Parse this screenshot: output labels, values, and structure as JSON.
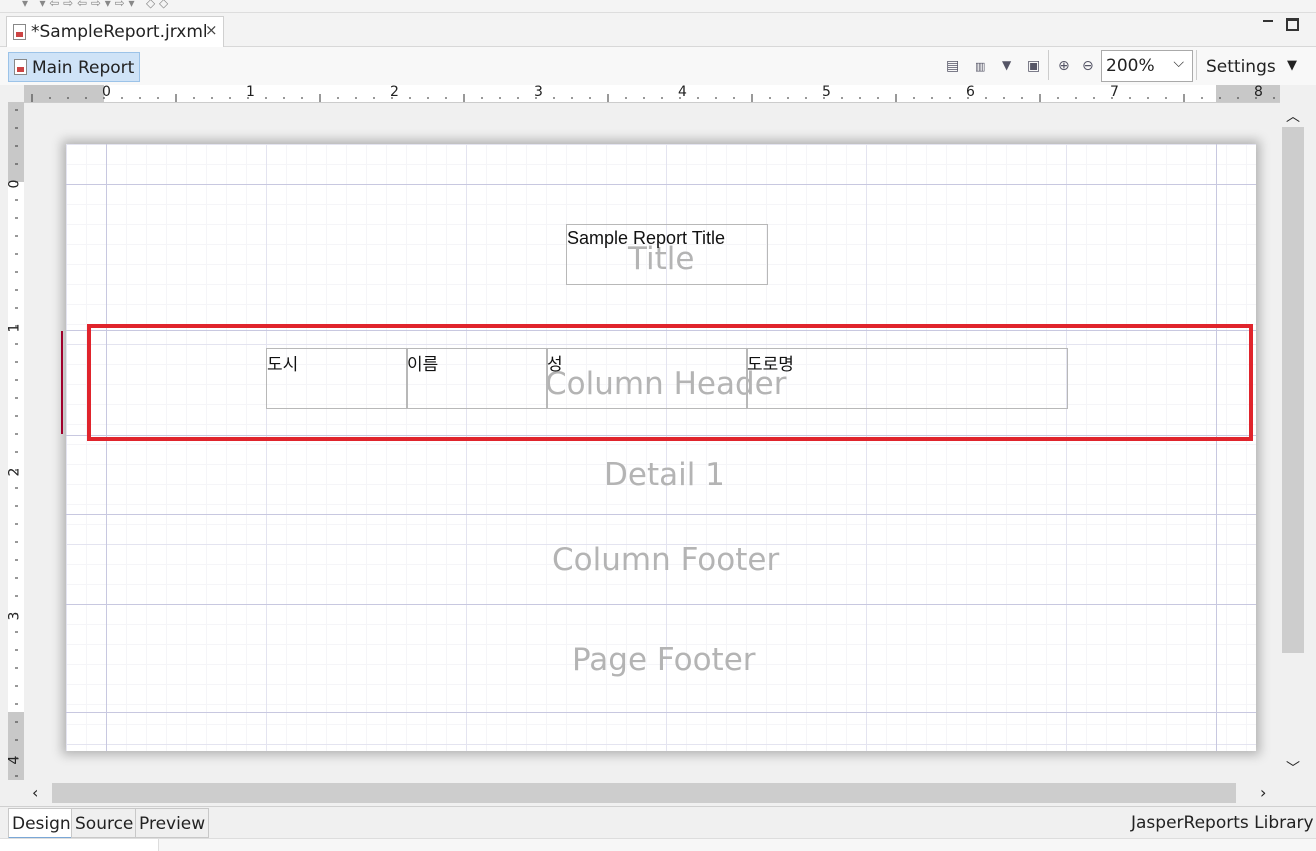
{
  "editor": {
    "tab_title": "*SampleReport.jrxml",
    "close_glyph": "×"
  },
  "toolbar": {
    "main_report_label": "Main Report",
    "zoom_value": "200%",
    "settings_label": "Settings"
  },
  "ruler": {
    "horizontal_labels": [
      "0",
      "1",
      "2",
      "3",
      "4",
      "5",
      "6",
      "7",
      "8"
    ],
    "vertical_labels": [
      "0",
      "1",
      "2",
      "3",
      "4"
    ]
  },
  "report": {
    "title_text": "Sample Report Title",
    "column_headers": [
      "도시",
      "이름",
      "성",
      "도로명"
    ],
    "bands": {
      "title": "Title",
      "column_header": "Column Header",
      "detail": "Detail 1",
      "column_footer": "Column Footer",
      "page_footer": "Page Footer"
    }
  },
  "bottom_tabs": [
    "Design",
    "Source",
    "Preview"
  ],
  "library_label": "JasperReports Library",
  "colors": {
    "highlight": "#e0242c",
    "selected_tab_bg": "#cfe3f7"
  },
  "icons": [
    "report-file-icon",
    "close-icon",
    "minimize-icon",
    "maximize-icon",
    "zoom-in-icon",
    "zoom-out-icon",
    "dropdown-chevron-icon",
    "scroll-up-icon",
    "scroll-down-icon",
    "scroll-left-icon",
    "scroll-right-icon"
  ]
}
